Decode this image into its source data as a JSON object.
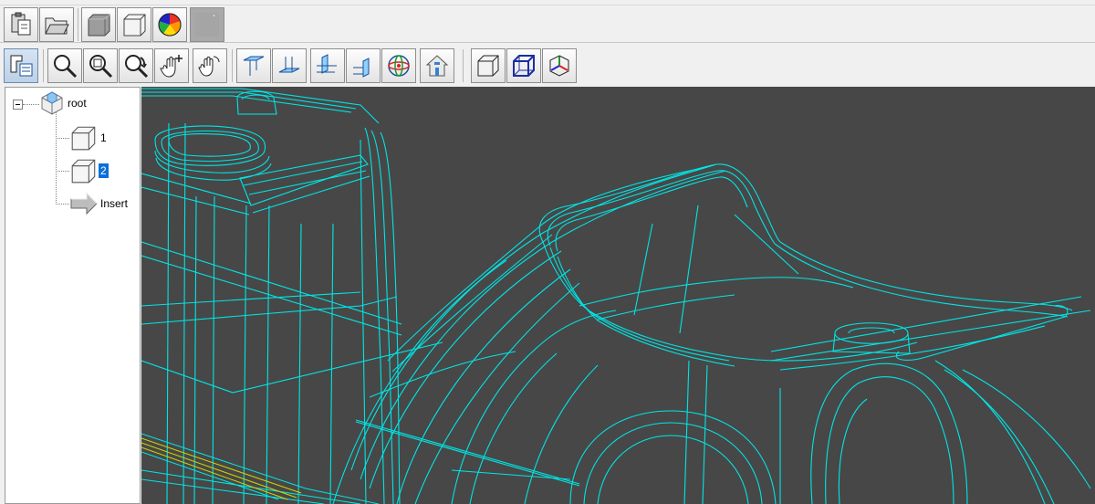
{
  "toolbar_top": {
    "buttons": [
      {
        "name": "paste-icon"
      },
      {
        "name": "open-folder-icon"
      },
      {
        "name": "solid-box-icon"
      },
      {
        "name": "shaded-box-icon"
      },
      {
        "name": "color-wheel-icon"
      },
      {
        "name": "blank-panel-icon"
      }
    ]
  },
  "toolbar_view": {
    "buttons": [
      {
        "name": "select-tree-icon"
      },
      {
        "name": "zoom-icon"
      },
      {
        "name": "zoom-window-icon"
      },
      {
        "name": "zoom-rotate-icon"
      },
      {
        "name": "pan-hand-icon"
      },
      {
        "name": "rotate-hand-icon"
      },
      {
        "name": "view-top-icon"
      },
      {
        "name": "view-bottom-icon"
      },
      {
        "name": "view-left-icon"
      },
      {
        "name": "view-right-icon"
      },
      {
        "name": "orbit-icon"
      },
      {
        "name": "home-view-icon"
      },
      {
        "name": "display-solid-icon"
      },
      {
        "name": "display-wireframe-icon"
      },
      {
        "name": "display-axes-icon"
      }
    ]
  },
  "tree": {
    "root": "root",
    "children": [
      {
        "label": "1",
        "selected": false
      },
      {
        "label": "2",
        "selected": true
      }
    ],
    "insert": "Insert"
  },
  "viewport": {
    "background": "#474747",
    "wire_color": "#00e5e5",
    "highlight_color": "#e6e600"
  }
}
